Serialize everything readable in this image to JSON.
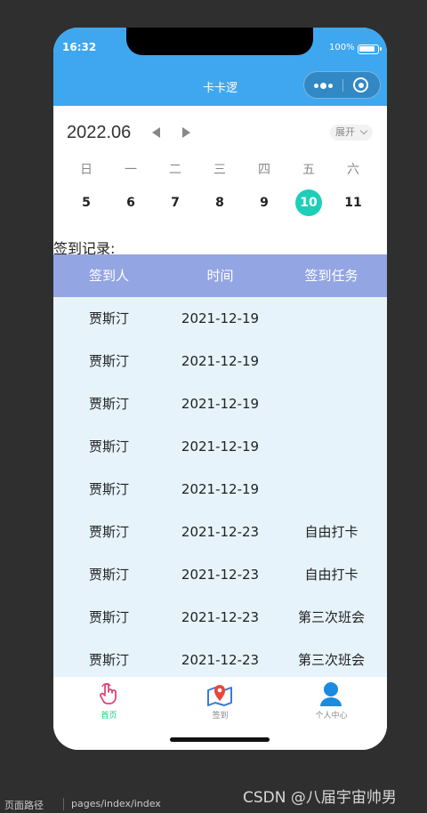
{
  "status_bar": {
    "time": "16:32",
    "battery": "100%"
  },
  "nav": {
    "title": "卡卡逻"
  },
  "calendar": {
    "month": "2022.06",
    "expand_label": "展开",
    "weekdays": [
      "日",
      "一",
      "二",
      "三",
      "四",
      "五",
      "六"
    ],
    "days": [
      "5",
      "6",
      "7",
      "8",
      "9",
      "10",
      "11"
    ],
    "selected_day": "10"
  },
  "records": {
    "label": "签到记录:",
    "headers": [
      "签到人",
      "时间",
      "签到任务"
    ],
    "rows": [
      [
        "贾斯汀",
        "2021-12-19",
        ""
      ],
      [
        "贾斯汀",
        "2021-12-19",
        ""
      ],
      [
        "贾斯汀",
        "2021-12-19",
        ""
      ],
      [
        "贾斯汀",
        "2021-12-19",
        ""
      ],
      [
        "贾斯汀",
        "2021-12-19",
        ""
      ],
      [
        "贾斯汀",
        "2021-12-23",
        "自由打卡"
      ],
      [
        "贾斯汀",
        "2021-12-23",
        "自由打卡"
      ],
      [
        "贾斯汀",
        "2021-12-23",
        "第三次班会"
      ],
      [
        "贾斯汀",
        "2021-12-23",
        "第三次班会"
      ]
    ]
  },
  "tabbar": {
    "items": [
      {
        "label": "首页",
        "icon": "hand-pointer-icon",
        "active": true
      },
      {
        "label": "签到",
        "icon": "map-pin-icon",
        "active": false
      },
      {
        "label": "个人中心",
        "icon": "user-icon",
        "active": false
      }
    ]
  },
  "footer": {
    "path_label": "页面路径",
    "route": "pages/index/index"
  },
  "watermark": "CSDN @八届宇宙帅男",
  "colors": {
    "header": "#3ea7f0",
    "selected_day": "#1ecfb8",
    "table_head": "#93a5e2",
    "table_body": "#e6f3fa",
    "active_tab": "#1ecf7c"
  }
}
